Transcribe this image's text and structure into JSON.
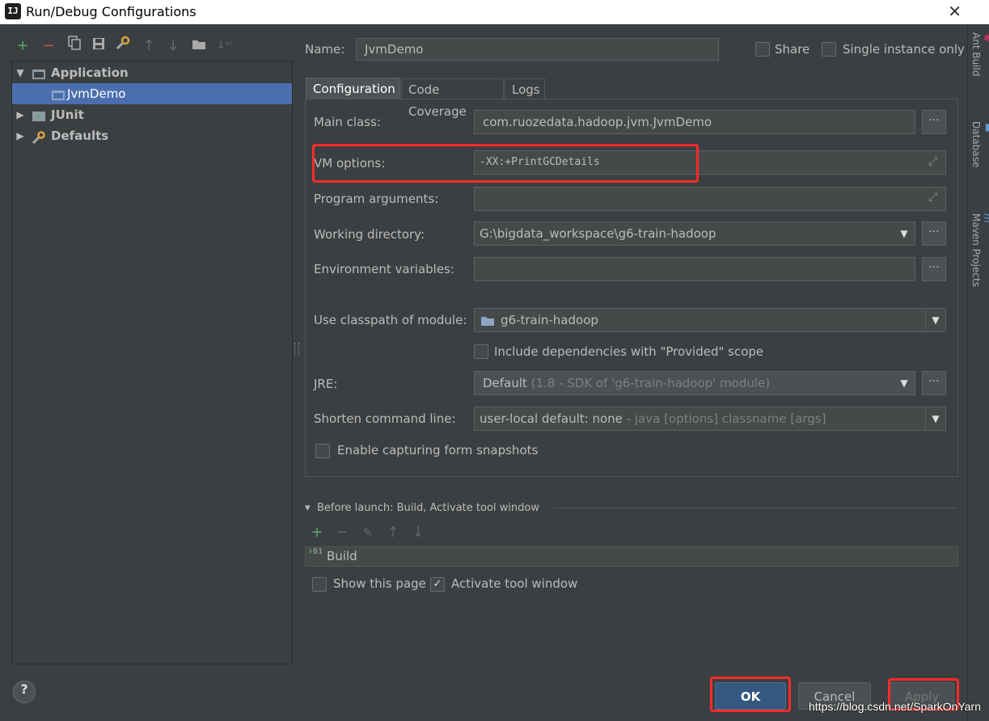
{
  "window": {
    "title": "Run/Debug Configurations",
    "app_icon": "intellij-icon",
    "close_glyph": "✕"
  },
  "toolbar": {
    "add": "+",
    "remove": "−",
    "copy": "copy-icon",
    "save": "save-icon",
    "edit_defaults": "wrench-icon",
    "move_up": "↑",
    "move_down": "↓",
    "folder": "folder-icon",
    "sort": "sort-icon"
  },
  "tree": {
    "items": [
      {
        "label": "Application",
        "expanded": true
      },
      {
        "label": "JvmDemo",
        "selected": true
      },
      {
        "label": "JUnit",
        "expanded": false
      },
      {
        "label": "Defaults",
        "expanded": false
      }
    ]
  },
  "header": {
    "name_label": "Name:",
    "name_value": "JvmDemo",
    "share_label": "Share",
    "single_instance_label": "Single instance only"
  },
  "tabs": [
    {
      "label": "Configuration",
      "active": true
    },
    {
      "label": "Code Coverage"
    },
    {
      "label": "Logs"
    }
  ],
  "form": {
    "main_class": {
      "label": "Main class:",
      "value": "com.ruozedata.hadoop.jvm.JvmDemo"
    },
    "vm_options": {
      "label": "VM options:",
      "value": "-XX:+PrintGCDetails"
    },
    "program_arguments": {
      "label": "Program arguments:",
      "value": ""
    },
    "working_directory": {
      "label": "Working directory:",
      "value": "G:\\bigdata_workspace\\g6-train-hadoop"
    },
    "environment_variables": {
      "label": "Environment variables:",
      "value": ""
    },
    "classpath_module": {
      "label": "Use classpath of module:",
      "value": "g6-train-hadoop"
    },
    "include_provided": {
      "label": "Include dependencies with \"Provided\" scope",
      "checked": false
    },
    "jre": {
      "label": "JRE:",
      "value": "Default",
      "hint": "(1.8 - SDK of 'g6-train-hadoop' module)"
    },
    "shorten_cmd": {
      "label": "Shorten command line:",
      "value": "user-local default: none",
      "hint": "- java [options] classname [args]"
    },
    "form_snapshots": {
      "label": "Enable capturing form snapshots",
      "checked": false
    },
    "dots_glyph": "...",
    "dropdown_glyph": "▼",
    "expand_glyph": "⤢"
  },
  "before_launch": {
    "title": "Before launch: Build, Activate tool window",
    "items": [
      "Build"
    ],
    "show_page_label": "Show this page",
    "show_page_checked": false,
    "activate_tool_label": "Activate tool window",
    "activate_tool_checked": true
  },
  "right_strip": [
    "Ant Build",
    "Database",
    "Maven Projects"
  ],
  "buttons": {
    "ok": "OK",
    "cancel": "Cancel",
    "apply": "Apply",
    "help": "?"
  },
  "watermark": "https://blog.csdn.net/SparkOnYarn",
  "colors": {
    "accent": "#4b6eaf",
    "highlight": "#ff2b2b",
    "ok": "#365880",
    "add": "#59a869",
    "remove": "#c75450"
  }
}
